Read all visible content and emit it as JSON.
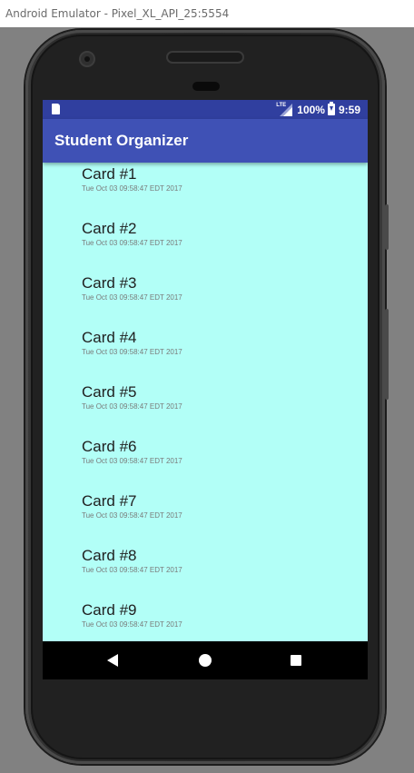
{
  "window": {
    "title": "Android Emulator - Pixel_XL_API_25:5554"
  },
  "status_bar": {
    "network": "LTE",
    "battery": "100%",
    "time": "9:59"
  },
  "app_bar": {
    "title": "Student Organizer"
  },
  "cards": [
    {
      "title": "Card #1",
      "date": "Tue Oct 03 09:58:47 EDT 2017"
    },
    {
      "title": "Card #2",
      "date": "Tue Oct 03 09:58:47 EDT 2017"
    },
    {
      "title": "Card #3",
      "date": "Tue Oct 03 09:58:47 EDT 2017"
    },
    {
      "title": "Card #4",
      "date": "Tue Oct 03 09:58:47 EDT 2017"
    },
    {
      "title": "Card #5",
      "date": "Tue Oct 03 09:58:47 EDT 2017"
    },
    {
      "title": "Card #6",
      "date": "Tue Oct 03 09:58:47 EDT 2017"
    },
    {
      "title": "Card #7",
      "date": "Tue Oct 03 09:58:47 EDT 2017"
    },
    {
      "title": "Card #8",
      "date": "Tue Oct 03 09:58:47 EDT 2017"
    },
    {
      "title": "Card #9",
      "date": "Tue Oct 03 09:58:47 EDT 2017"
    }
  ],
  "nav": {
    "icons": [
      "back-icon",
      "home-icon",
      "recents-icon"
    ]
  },
  "colors": {
    "status_bar": "#303f9f",
    "app_bar": "#3f51b5",
    "list_background": "#b2fff7"
  }
}
